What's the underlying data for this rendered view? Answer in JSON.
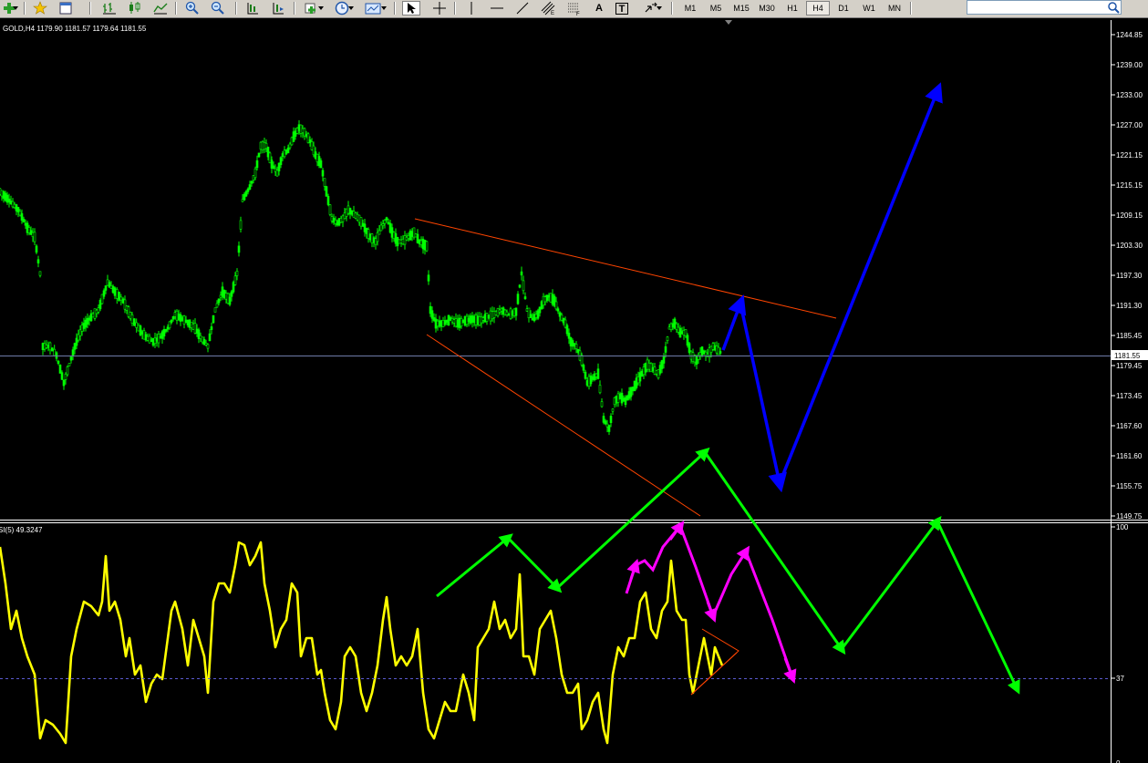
{
  "toolbar": {
    "timeframes": [
      "M1",
      "M5",
      "M15",
      "M30",
      "H1",
      "H4",
      "D1",
      "W1",
      "MN"
    ],
    "text_tool": "A",
    "label_tool": "T"
  },
  "chart": {
    "info": "GOLD,H4  1179.90 1181.57 1179.64 1181.55",
    "current_price_label": "1181.55",
    "price_axis_labels": [
      "1244.85",
      "1239.00",
      "1233.00",
      "1227.00",
      "1221.15",
      "1215.15",
      "1209.15",
      "1203.30",
      "1197.30",
      "1191.30",
      "1185.45",
      "1179.45",
      "1173.45",
      "1167.60",
      "1161.60",
      "1155.75",
      "1149.75"
    ],
    "colors": {
      "candles": "#00ff00",
      "trendlines": "#ff4500",
      "bid_line": "#6e7ba8",
      "rsi_line": "#ffff00",
      "arrow_blue": "#0000ff",
      "arrow_green": "#00ff00",
      "arrow_magenta": "#ff00ff"
    }
  },
  "indicator": {
    "info": "SI(5) 49.3247",
    "axis_labels": [
      "100",
      "37",
      "0"
    ]
  }
}
